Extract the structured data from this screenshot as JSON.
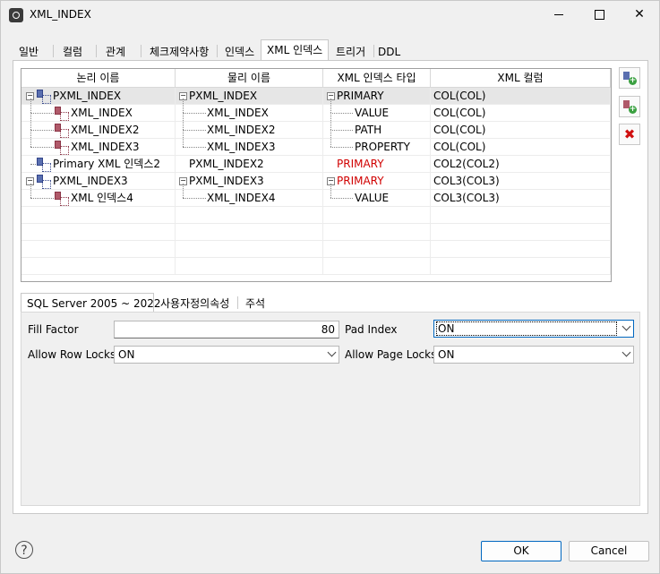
{
  "window": {
    "title": "XML_INDEX"
  },
  "tabs": [
    "일반",
    "컬럼",
    "관계",
    "체크제약사항",
    "인덱스",
    "XML 인덱스",
    "트리거",
    "DDL"
  ],
  "grid": {
    "columns": [
      "논리 이름",
      "물리 이름",
      "XML 인덱스 타입",
      "XML 컬럼"
    ],
    "rows": [
      {
        "logical": "PXML_INDEX",
        "physical": "PXML_INDEX",
        "type": "PRIMARY",
        "column": "COL(COL)"
      },
      {
        "logical": "XML_INDEX",
        "physical": "XML_INDEX",
        "type": "VALUE",
        "column": "COL(COL)"
      },
      {
        "logical": "XML_INDEX2",
        "physical": "XML_INDEX2",
        "type": "PATH",
        "column": "COL(COL)"
      },
      {
        "logical": "XML_INDEX3",
        "physical": "XML_INDEX3",
        "type": "PROPERTY",
        "column": "COL(COL)"
      },
      {
        "logical": "Primary XML 인덱스2",
        "physical": "PXML_INDEX2",
        "type": "PRIMARY",
        "column": "COL2(COL2)"
      },
      {
        "logical": "PXML_INDEX3",
        "physical": "PXML_INDEX3",
        "type": "PRIMARY",
        "column": "COL3(COL3)"
      },
      {
        "logical": "XML 인덱스4",
        "physical": "XML_INDEX4",
        "type": "VALUE",
        "column": "COL3(COL3)"
      }
    ]
  },
  "subtabs": [
    "SQL Server 2005 ~ 2022",
    "사용자정의속성",
    "주석"
  ],
  "options": {
    "fill_factor_label": "Fill Factor",
    "fill_factor_value": "80",
    "pad_index_label": "Pad Index",
    "pad_index_value": "ON",
    "row_locks_label": "Allow Row Locks",
    "row_locks_value": "ON",
    "page_locks_label": "Allow Page Locks",
    "page_locks_value": "ON"
  },
  "buttons": {
    "help": "?",
    "ok": "OK",
    "cancel": "Cancel"
  },
  "colors": {
    "accent": "#0067c0",
    "warning_text": "#d00000"
  }
}
